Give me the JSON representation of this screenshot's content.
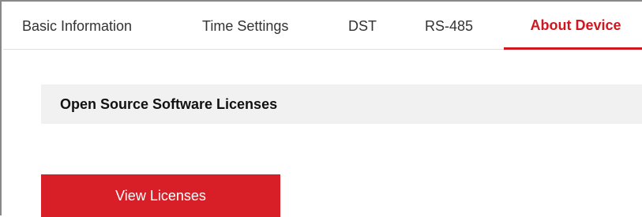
{
  "tabs": [
    {
      "label": "Basic Information"
    },
    {
      "label": "Time Settings"
    },
    {
      "label": "DST"
    },
    {
      "label": "RS-485"
    },
    {
      "label": "About Device",
      "active": true
    }
  ],
  "section": {
    "title": "Open Source Software Licenses"
  },
  "actions": {
    "view_licenses_label": "View Licenses"
  },
  "colors": {
    "accent": "#d0161e",
    "button_bg": "#d81e26",
    "section_bg": "#f1f1f1"
  }
}
